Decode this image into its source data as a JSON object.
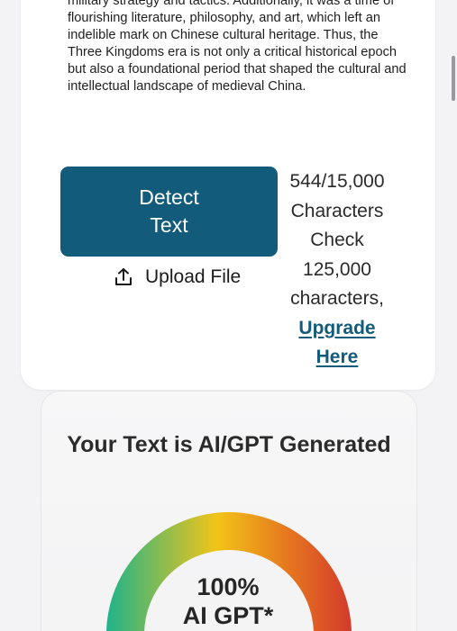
{
  "article": {
    "text": "military strategy and tactics. Additionally, it was a time of flourishing literature, philosophy, and art, which left an indelible mark on Chinese cultural heritage. Thus, the Three Kingdoms era is not only a critical historical epoch but also a foundational period that shaped the cultural and intellectual landscape of medieval China."
  },
  "actions": {
    "detect_label": "Detect Text",
    "upload_label": "Upload File"
  },
  "counter": {
    "count": "544/15,000",
    "unit": "Characters",
    "check_line1": "Check",
    "check_line2": "125,000",
    "check_line3": "characters,",
    "upgrade_line1": "Upgrade",
    "upgrade_line2": "Here"
  },
  "result": {
    "title": "Your Text is AI/GPT Generated",
    "percent_label": "100%",
    "kind_label": "AI GPT*",
    "percent_value": 1.0
  },
  "colors": {
    "primary": "#135b7a",
    "gauge_gradient": [
      "#1fb38a",
      "#f2c418",
      "#e5751f",
      "#d33a2c"
    ]
  },
  "icons": {
    "upload": "upload-icon"
  }
}
